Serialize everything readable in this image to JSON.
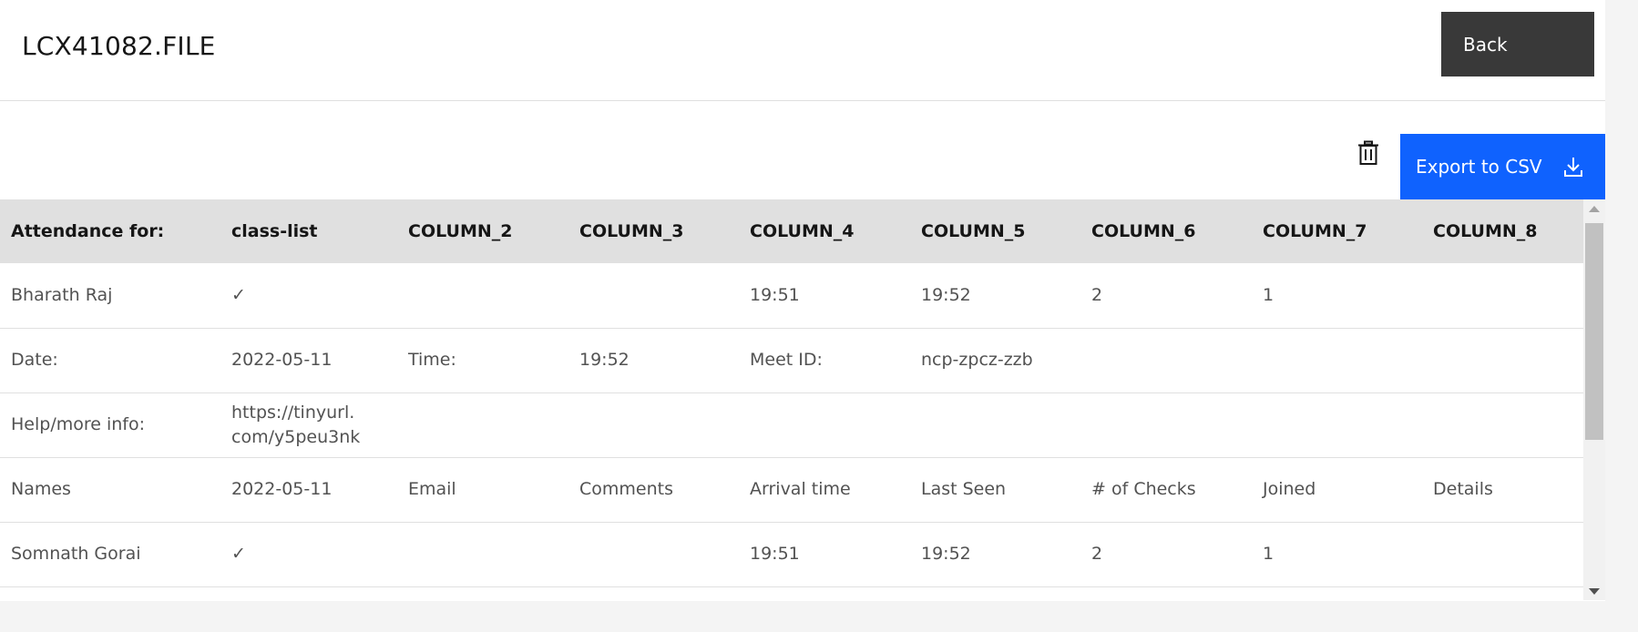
{
  "header": {
    "title": "LCX41082.FILE",
    "back_label": "Back"
  },
  "toolbar": {
    "delete_icon": "trash-icon",
    "export_label": "Export to CSV",
    "export_icon": "download-icon"
  },
  "colors": {
    "accent": "#0f62fe",
    "back_button": "#393939",
    "table_header": "#e0e0e0"
  },
  "table": {
    "columns": [
      "Attendance for:",
      "class-list",
      "COLUMN_2",
      "COLUMN_3",
      "COLUMN_4",
      "COLUMN_5",
      "COLUMN_6",
      "COLUMN_7",
      "COLUMN_8"
    ],
    "rows": [
      [
        "Bharath Raj",
        "✓",
        "",
        "",
        "19:51",
        "19:52",
        "2",
        "1",
        ""
      ],
      [
        "Date:",
        "2022-05-11",
        "Time:",
        "19:52",
        "Meet ID:",
        "ncp-zpcz-zzb",
        "",
        "",
        ""
      ],
      [
        "Help/more info:",
        "https://tinyurl.\ncom/y5peu3nk",
        "",
        "",
        "",
        "",
        "",
        "",
        ""
      ],
      [
        "Names",
        "2022-05-11",
        "Email",
        "Comments",
        "Arrival time",
        "Last Seen",
        "# of Checks",
        "Joined",
        "Details"
      ],
      [
        "Somnath Gorai",
        "✓",
        "",
        "",
        "19:51",
        "19:52",
        "2",
        "1",
        ""
      ]
    ]
  }
}
